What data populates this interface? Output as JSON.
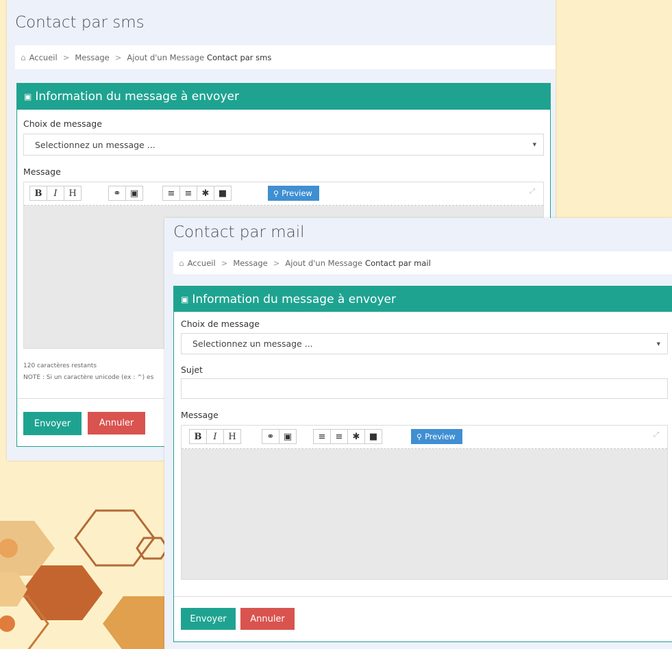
{
  "colors": {
    "background": "#fdf0c8",
    "panel_header": "#1fa391",
    "send": "#1fa391",
    "cancel": "#d9534f",
    "preview": "#3f8fd2"
  },
  "icons": {
    "home": "home-icon",
    "header": "lock-icon",
    "preview": "search-icon",
    "expand": "expand-icon"
  },
  "sms": {
    "title": "Contact par sms",
    "breadcrumb": {
      "home": "Accueil",
      "message": "Message",
      "add": "Ajout d'un Message",
      "current": "Contact par sms"
    },
    "panel_title": "Information du message à envoyer",
    "choice_label": "Choix de message",
    "select_value": "Selectionnez un message ...",
    "message_label": "Message",
    "toolbar": {
      "bold": "B",
      "italic": "I",
      "heading": "H",
      "preview": "Preview"
    },
    "chars_left": "120 caractères restants",
    "note": "NOTE : Si un caractère unicode (ex : ^) es",
    "send": "Envoyer",
    "cancel": "Annuler"
  },
  "mail": {
    "title": "Contact par mail",
    "breadcrumb": {
      "home": "Accueil",
      "message": "Message",
      "add": "Ajout d'un Message",
      "current": "Contact par mail"
    },
    "panel_title": "Information du message à envoyer",
    "choice_label": "Choix de message",
    "select_value": "Selectionnez un message ...",
    "subject_label": "Sujet",
    "subject_value": "",
    "message_label": "Message",
    "toolbar": {
      "bold": "B",
      "italic": "I",
      "heading": "H",
      "preview": "Preview"
    },
    "send": "Envoyer",
    "cancel": "Annuler"
  }
}
